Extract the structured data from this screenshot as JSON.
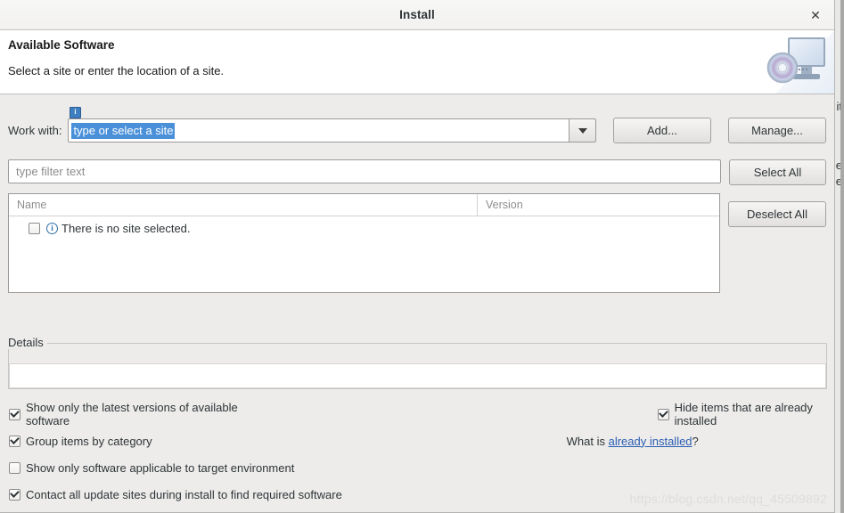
{
  "window": {
    "title": "Install",
    "close_label": "✕"
  },
  "banner": {
    "title": "Available Software",
    "subtitle": "Select a site or enter the location of a site.",
    "icon": "monitor-disc-icon"
  },
  "work_with": {
    "label": "Work with:",
    "info_badge": "i",
    "combo_value": "type or select a site",
    "combo_selected": true,
    "dropdown_icon": "chevron-down-icon",
    "add_label": "Add...",
    "manage_label": "Manage..."
  },
  "filter": {
    "placeholder": "type filter text",
    "value": ""
  },
  "side_buttons": {
    "select_all": "Select All",
    "deselect_all": "Deselect All"
  },
  "table": {
    "columns": [
      "Name",
      "Version"
    ],
    "rows": [
      {
        "checked": false,
        "icon": "info-circle-icon",
        "name": "There is no site selected.",
        "version": ""
      }
    ]
  },
  "details": {
    "legend": "Details",
    "content": ""
  },
  "options": [
    {
      "label": "Show only the latest versions of available software",
      "checked": true
    },
    {
      "label": "Hide items that are already installed",
      "checked": true
    },
    {
      "label": "Group items by category",
      "checked": true
    },
    {
      "label": "Show only software applicable to target environment",
      "checked": false
    },
    {
      "label": "Contact all update sites during install to find required software",
      "checked": true
    }
  ],
  "what_is": {
    "prefix": "What is ",
    "link": "already installed",
    "suffix": "?"
  },
  "watermark": "https://blog.csdn.net/qq_45509892",
  "background": {
    "frag1": "it",
    "frag2": "e",
    "frag3": "de"
  },
  "colors": {
    "selection_blue": "#4a90d9",
    "link_blue": "#2a5db0",
    "dialog_bg": "#edeceb",
    "info_blue": "#3e7fc1"
  }
}
